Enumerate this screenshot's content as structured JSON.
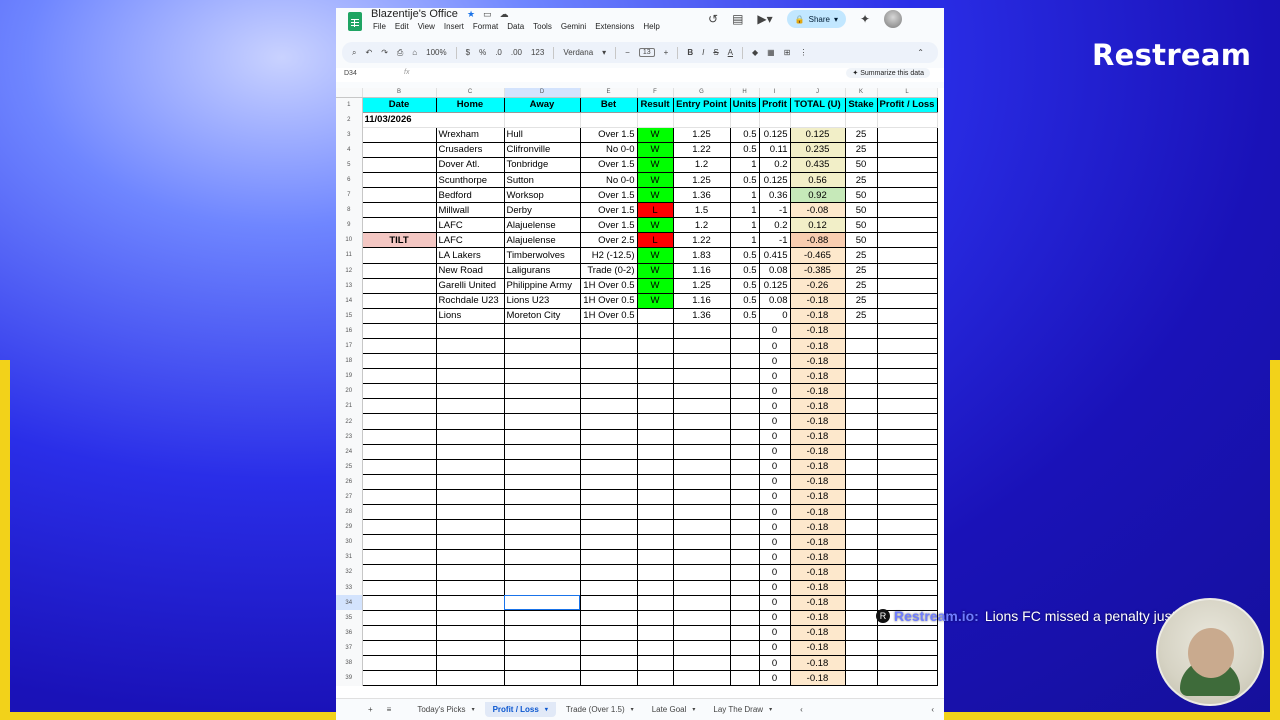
{
  "overlay": {
    "logo": "Restream",
    "ticker_brand": "Restream.io:",
    "ticker_message": "Lions FC missed a penalty just now!"
  },
  "app": {
    "title": "Blazentije's Office",
    "menu": [
      "File",
      "Edit",
      "View",
      "Insert",
      "Format",
      "Data",
      "Tools",
      "Gemini",
      "Extensions",
      "Help"
    ],
    "share_label": "Share"
  },
  "toolbar": {
    "zoom": "100%",
    "currency": "$",
    "percent": "%",
    "decimals_a": ".0",
    "decimals_b": ".00",
    "format_123": "123",
    "font": "Verdana",
    "font_size": "13",
    "bold": "B",
    "italic": "I",
    "strike": "S",
    "text_color": "A"
  },
  "formula_bar": {
    "name_box": "D34",
    "fx": "fx",
    "summarize": "Summarize this data"
  },
  "columns": [
    "B",
    "C",
    "D",
    "E",
    "F",
    "G",
    "H",
    "I",
    "J",
    "K",
    "L"
  ],
  "selected_column": "D",
  "selected_row": "34",
  "headers": [
    "Date",
    "Home",
    "Away",
    "Bet",
    "Result",
    "Entry Point",
    "Units",
    "Profit",
    "TOTAL (U)",
    "Stake",
    "Profit / Loss"
  ],
  "date_row": {
    "row": "2",
    "date": "11/03/2026"
  },
  "rows": [
    {
      "row": "3",
      "date": "",
      "home": "Wrexham",
      "away": "Hull",
      "bet": "Over 1.5",
      "result": "W",
      "entry": "1.25",
      "units": "0.5",
      "profit": "0.125",
      "total": "0.125",
      "stake": "25"
    },
    {
      "row": "4",
      "date": "",
      "home": "Crusaders",
      "away": "Clifronville",
      "bet": "No 0-0",
      "result": "W",
      "entry": "1.22",
      "units": "0.5",
      "profit": "0.11",
      "total": "0.235",
      "stake": "25"
    },
    {
      "row": "5",
      "date": "",
      "home": "Dover Atl.",
      "away": "Tonbridge",
      "bet": "Over 1.5",
      "result": "W",
      "entry": "1.2",
      "units": "1",
      "profit": "0.2",
      "total": "0.435",
      "stake": "50"
    },
    {
      "row": "6",
      "date": "",
      "home": "Scunthorpe",
      "away": "Sutton",
      "bet": "No 0-0",
      "result": "W",
      "entry": "1.25",
      "units": "0.5",
      "profit": "0.125",
      "total": "0.56",
      "stake": "25"
    },
    {
      "row": "7",
      "date": "",
      "home": "Bedford",
      "away": "Worksop",
      "bet": "Over 1.5",
      "result": "W",
      "entry": "1.36",
      "units": "1",
      "profit": "0.36",
      "total": "0.92",
      "stake": "50"
    },
    {
      "row": "8",
      "date": "",
      "home": "Millwall",
      "away": "Derby",
      "bet": "Over 1.5",
      "result": "L",
      "entry": "1.5",
      "units": "1",
      "profit": "-1",
      "total": "-0.08",
      "stake": "50"
    },
    {
      "row": "9",
      "date": "",
      "home": "LAFC",
      "away": "Alajuelense",
      "bet": "Over 1.5",
      "result": "W",
      "entry": "1.2",
      "units": "1",
      "profit": "0.2",
      "total": "0.12",
      "stake": "50"
    },
    {
      "row": "10",
      "date": "TILT",
      "home": "LAFC",
      "away": "Alajuelense",
      "bet": "Over 2.5",
      "result": "L",
      "entry": "1.22",
      "units": "1",
      "profit": "-1",
      "total": "-0.88",
      "stake": "50"
    },
    {
      "row": "11",
      "date": "",
      "home": "LA Lakers",
      "away": "Timberwolves",
      "bet": "H2 (-12.5)",
      "result": "W",
      "entry": "1.83",
      "units": "0.5",
      "profit": "0.415",
      "total": "-0.465",
      "stake": "25"
    },
    {
      "row": "12",
      "date": "",
      "home": "New Road",
      "away": "Laligurans",
      "bet": "Trade (0-2)",
      "result": "W",
      "entry": "1.16",
      "units": "0.5",
      "profit": "0.08",
      "total": "-0.385",
      "stake": "25"
    },
    {
      "row": "13",
      "date": "",
      "home": "Garelli United",
      "away": "Philippine Army",
      "bet": "1H Over 0.5",
      "result": "W",
      "entry": "1.25",
      "units": "0.5",
      "profit": "0.125",
      "total": "-0.26",
      "stake": "25"
    },
    {
      "row": "14",
      "date": "",
      "home": "Rochdale U23",
      "away": "Lions U23",
      "bet": "1H Over 0.5",
      "result": "W",
      "entry": "1.16",
      "units": "0.5",
      "profit": "0.08",
      "total": "-0.18",
      "stake": "25"
    },
    {
      "row": "15",
      "date": "",
      "home": "Lions",
      "away": "Moreton City",
      "bet": "1H Over 0.5",
      "result": "",
      "entry": "1.36",
      "units": "0.5",
      "profit": "0",
      "total": "-0.18",
      "stake": "25"
    }
  ],
  "empty_rows": {
    "from": 16,
    "to": 39,
    "profit": "0",
    "total": "-0.18"
  },
  "tabs": [
    {
      "label": "Today's Picks",
      "active": false
    },
    {
      "label": "Profit / Loss",
      "active": true
    },
    {
      "label": "Trade (Over 1.5)",
      "active": false
    },
    {
      "label": "Late Goal",
      "active": false
    },
    {
      "label": "Lay The Draw",
      "active": false
    }
  ],
  "colors": {
    "header_bg": "#00ffff",
    "win": "#00ff00",
    "loss": "#ff0000",
    "tilt": "#f4c7c3",
    "total_bg": "#fde8cc"
  }
}
